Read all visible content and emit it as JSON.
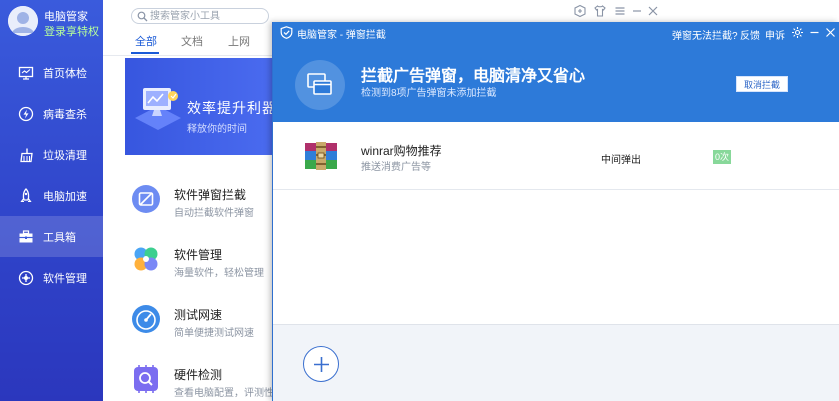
{
  "sidebar": {
    "user_name": "电脑管家",
    "vip_link": "登录享特权",
    "items": [
      {
        "label": "首页体检",
        "icon": "monitor-icon"
      },
      {
        "label": "病毒查杀",
        "icon": "lightning-icon"
      },
      {
        "label": "垃圾清理",
        "icon": "broom-icon"
      },
      {
        "label": "电脑加速",
        "icon": "rocket-icon"
      },
      {
        "label": "工具箱",
        "icon": "toolbox-icon",
        "active": true
      },
      {
        "label": "软件管理",
        "icon": "apps-icon"
      }
    ]
  },
  "main": {
    "search": {
      "placeholder": "搜索管家小工具",
      "value": ""
    },
    "tabs": [
      {
        "label": "全部",
        "active": true
      },
      {
        "label": "文档",
        "active": false
      },
      {
        "label": "上网",
        "active": false
      }
    ],
    "banner": {
      "title": "效率提升利器",
      "subtitle": "释放你的时间"
    },
    "tools": [
      {
        "title": "软件弹窗拦截",
        "desc": "自动拦截软件弹窗",
        "icon": "popup-block-icon"
      },
      {
        "title": "软件管理",
        "desc": "海量软件，轻松管理",
        "icon": "clover-icon"
      },
      {
        "title": "测试网速",
        "desc": "简单便捷测试网速",
        "icon": "speedometer-icon"
      },
      {
        "title": "硬件检测",
        "desc": "查看电脑配置，评测性能",
        "icon": "chip-search-icon"
      }
    ]
  },
  "popup": {
    "title": "电脑管家 - 弹窗拦截",
    "links": [
      "弹窗无法拦截?",
      "反馈",
      "申诉"
    ],
    "hero_title": "拦截广告弹窗，电脑清净又省心",
    "hero_subtitle": "检测到8项广告弹窗未添加拦截",
    "cancel_label": "取消拦截",
    "rows": [
      {
        "name": "winrar购物推荐",
        "desc": "推送消费广告等",
        "type": "中间弹出",
        "count": "0次",
        "icon": "winrar-icon"
      }
    ]
  },
  "colors": {
    "sidebar": "#3a5bdc",
    "popup_header": "#2d7ad9",
    "accent": "#1a5ad7",
    "badge": "#88d89a",
    "vip": "#b7ff9b"
  }
}
